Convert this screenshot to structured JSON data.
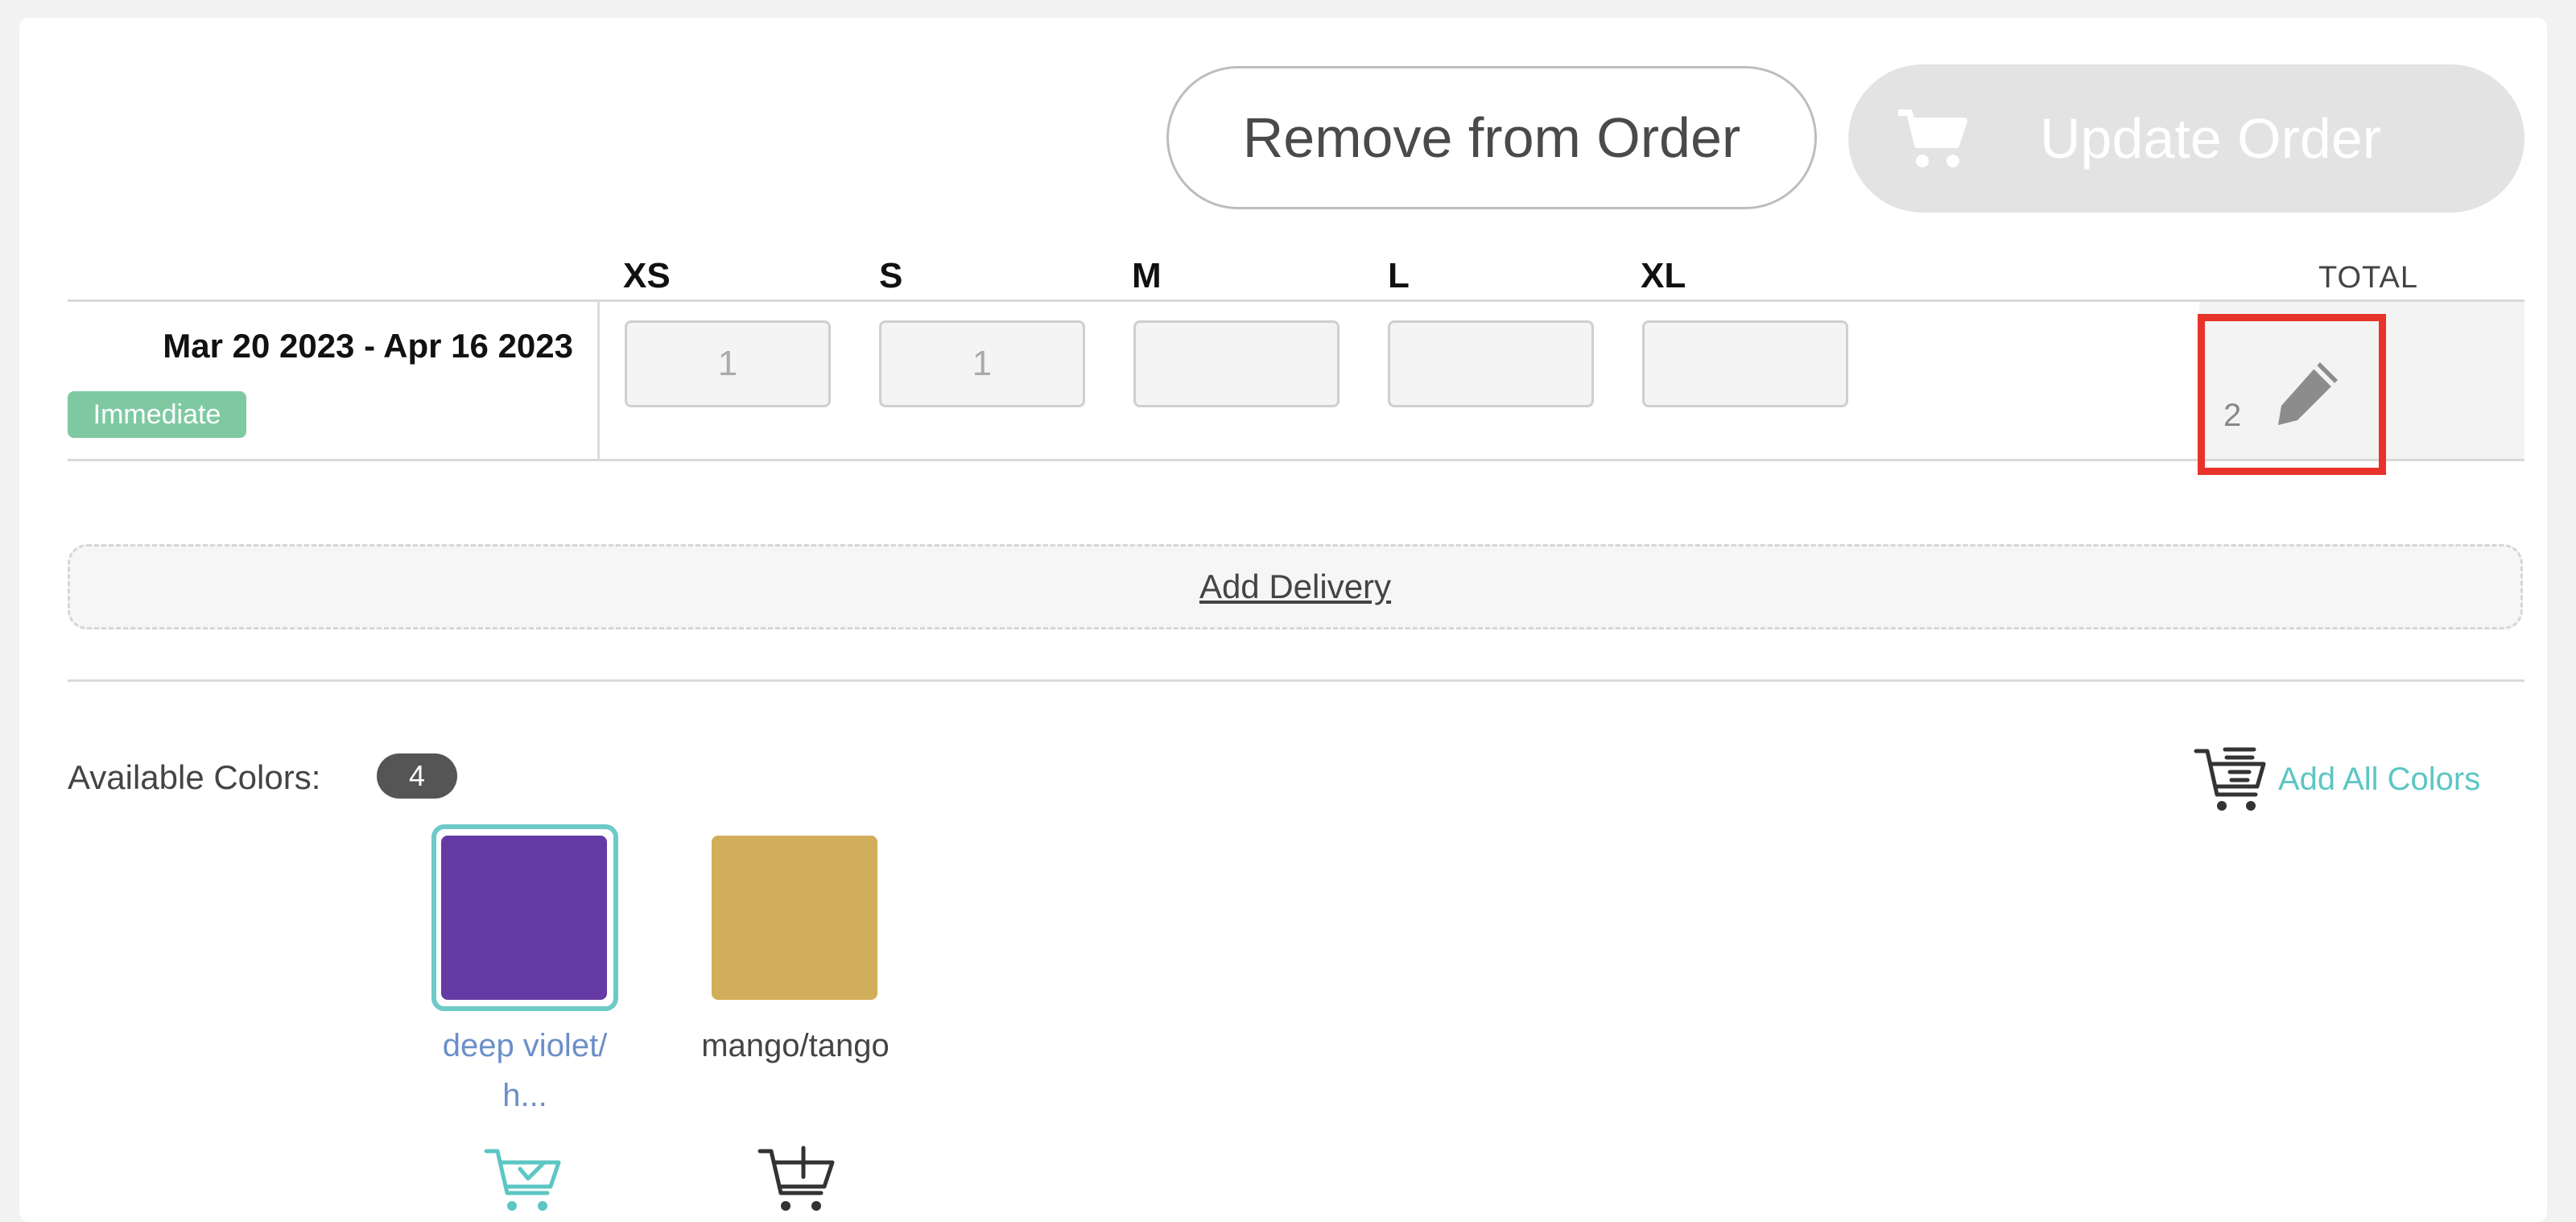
{
  "toolbar": {
    "remove_label": "Remove from Order",
    "update_label": "Update Order"
  },
  "sizes": {
    "headers": [
      "XS",
      "S",
      "M",
      "L",
      "XL"
    ],
    "total_label": "TOTAL"
  },
  "delivery": {
    "date_range": "Mar 20 2023 - Apr 16 2023",
    "badge": "Immediate",
    "quantities": [
      "1",
      "1",
      "",
      "",
      ""
    ],
    "total": "2"
  },
  "add_delivery_label": "Add Delivery",
  "colors": {
    "label": "Available Colors:",
    "count": "4",
    "add_all_label": "Add All Colors",
    "items": [
      {
        "name": "deep violet/h...",
        "hex": "#653aa5",
        "selected": true
      },
      {
        "name": "mango/tango",
        "hex": "#d1ae59",
        "selected": false
      }
    ]
  },
  "theme": {
    "accent": "#5cc6c4",
    "badge_green": "#7fc9a2",
    "highlight_red": "#e8332a"
  }
}
